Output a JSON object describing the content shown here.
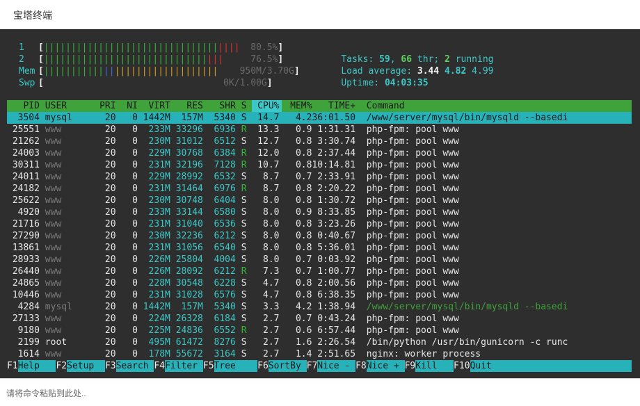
{
  "window": {
    "title": "宝塔终端"
  },
  "meters": [
    {
      "label": "1",
      "bars_green": "||||||||||||||||||||||||||||||||",
      "bars_blue": "",
      "bars_orange": "",
      "bars_red": "||||",
      "pad": "  ",
      "value": "80.5%"
    },
    {
      "label": "2",
      "bars_green": "||||||||||||||||||||||||||||||",
      "bars_blue": "",
      "bars_orange": "",
      "bars_red": "|||",
      "pad": "     ",
      "value": "76.5%"
    },
    {
      "label": "Mem",
      "bars_green": "|||||||||||",
      "bars_blue": "||",
      "bars_orange": "|||||||||||||||||||",
      "bars_red": "",
      "pad": "    ",
      "value": "950M/3.70G"
    },
    {
      "label": "Swp",
      "bars_green": "",
      "bars_blue": "",
      "bars_orange": "",
      "bars_red": "",
      "pad": "                                 ",
      "value": "0K/1.00G"
    }
  ],
  "stats": {
    "tasks_label": "Tasks: ",
    "tasks": "59",
    "thr": "66",
    "thr_label": " thr; ",
    "running": "2",
    "running_label": " running",
    "load_label": "Load average: ",
    "load1": "3.44",
    "load5": "4.82",
    "load15": "4.99",
    "uptime_label": "Uptime: ",
    "uptime": "04:03:35"
  },
  "columns": {
    "pid": "PID",
    "user": "USER",
    "pri": "PRI",
    "ni": "NI",
    "virt": "VIRT",
    "res": "RES",
    "shr": "SHR",
    "s": "S",
    "cpu": "CPU%",
    "mem": "MEM%",
    "time": "TIME+",
    "command": "Command"
  },
  "processes": [
    {
      "pid": "3504",
      "user": "mysql",
      "pri": "20",
      "ni": "0",
      "virt": "1442M",
      "res": "157M",
      "shr": "5340",
      "s": "S",
      "cpu": "14.7",
      "mem": "4.2",
      "time": "36:01.50",
      "command": "/www/server/mysql/bin/mysqld --basedi"
    },
    {
      "pid": "25551",
      "user": "www",
      "pri": "20",
      "ni": "0",
      "virt": "233M",
      "res": "33296",
      "shr": "6936",
      "s": "R",
      "cpu": "13.3",
      "mem": "0.9",
      "time": "1:31.31",
      "command": "php-fpm: pool www"
    },
    {
      "pid": "21262",
      "user": "www",
      "pri": "20",
      "ni": "0",
      "virt": "230M",
      "res": "31012",
      "shr": "6512",
      "s": "S",
      "cpu": "12.7",
      "mem": "0.8",
      "time": "3:30.74",
      "command": "php-fpm: pool www"
    },
    {
      "pid": "24003",
      "user": "www",
      "pri": "20",
      "ni": "0",
      "virt": "229M",
      "res": "30768",
      "shr": "6384",
      "s": "R",
      "cpu": "12.0",
      "mem": "0.8",
      "time": "2:37.44",
      "command": "php-fpm: pool www"
    },
    {
      "pid": "30311",
      "user": "www",
      "pri": "20",
      "ni": "0",
      "virt": "231M",
      "res": "32196",
      "shr": "7128",
      "s": "R",
      "cpu": "10.7",
      "mem": "0.8",
      "time": "10:14.81",
      "command": "php-fpm: pool www"
    },
    {
      "pid": "24011",
      "user": "www",
      "pri": "20",
      "ni": "0",
      "virt": "229M",
      "res": "28992",
      "shr": "6532",
      "s": "S",
      "cpu": "8.7",
      "mem": "0.7",
      "time": "2:33.91",
      "command": "php-fpm: pool www"
    },
    {
      "pid": "24182",
      "user": "www",
      "pri": "20",
      "ni": "0",
      "virt": "231M",
      "res": "31464",
      "shr": "6976",
      "s": "R",
      "cpu": "8.7",
      "mem": "0.8",
      "time": "2:20.22",
      "command": "php-fpm: pool www"
    },
    {
      "pid": "25622",
      "user": "www",
      "pri": "20",
      "ni": "0",
      "virt": "230M",
      "res": "30748",
      "shr": "6404",
      "s": "S",
      "cpu": "8.0",
      "mem": "0.8",
      "time": "1:30.72",
      "command": "php-fpm: pool www"
    },
    {
      "pid": "4920",
      "user": "www",
      "pri": "20",
      "ni": "0",
      "virt": "233M",
      "res": "33144",
      "shr": "6580",
      "s": "S",
      "cpu": "8.0",
      "mem": "0.9",
      "time": "8:33.85",
      "command": "php-fpm: pool www"
    },
    {
      "pid": "21716",
      "user": "www",
      "pri": "20",
      "ni": "0",
      "virt": "231M",
      "res": "31040",
      "shr": "6536",
      "s": "S",
      "cpu": "8.0",
      "mem": "0.8",
      "time": "3:23.26",
      "command": "php-fpm: pool www"
    },
    {
      "pid": "27290",
      "user": "www",
      "pri": "20",
      "ni": "0",
      "virt": "230M",
      "res": "32236",
      "shr": "6212",
      "s": "S",
      "cpu": "8.0",
      "mem": "0.8",
      "time": "0:40.67",
      "command": "php-fpm: pool www"
    },
    {
      "pid": "13861",
      "user": "www",
      "pri": "20",
      "ni": "0",
      "virt": "231M",
      "res": "31056",
      "shr": "6540",
      "s": "S",
      "cpu": "8.0",
      "mem": "0.8",
      "time": "5:36.01",
      "command": "php-fpm: pool www"
    },
    {
      "pid": "28933",
      "user": "www",
      "pri": "20",
      "ni": "0",
      "virt": "226M",
      "res": "25804",
      "shr": "4004",
      "s": "S",
      "cpu": "8.0",
      "mem": "0.7",
      "time": "0:03.92",
      "command": "php-fpm: pool www"
    },
    {
      "pid": "26440",
      "user": "www",
      "pri": "20",
      "ni": "0",
      "virt": "226M",
      "res": "28092",
      "shr": "6212",
      "s": "R",
      "cpu": "7.3",
      "mem": "0.7",
      "time": "1:00.77",
      "command": "php-fpm: pool www"
    },
    {
      "pid": "24865",
      "user": "www",
      "pri": "20",
      "ni": "0",
      "virt": "228M",
      "res": "30548",
      "shr": "6228",
      "s": "S",
      "cpu": "4.7",
      "mem": "0.8",
      "time": "2:00.56",
      "command": "php-fpm: pool www"
    },
    {
      "pid": "10446",
      "user": "www",
      "pri": "20",
      "ni": "0",
      "virt": "231M",
      "res": "31028",
      "shr": "6576",
      "s": "S",
      "cpu": "4.7",
      "mem": "0.8",
      "time": "6:38.35",
      "command": "php-fpm: pool www"
    },
    {
      "pid": "4284",
      "user": "mysql",
      "pri": "20",
      "ni": "0",
      "virt": "1442M",
      "res": "157M",
      "shr": "5340",
      "s": "S",
      "cpu": "3.3",
      "mem": "4.2",
      "time": "1:38.94",
      "command": "/www/server/mysql/bin/mysqld --basedi"
    },
    {
      "pid": "27133",
      "user": "www",
      "pri": "20",
      "ni": "0",
      "virt": "224M",
      "res": "26328",
      "shr": "6184",
      "s": "S",
      "cpu": "2.7",
      "mem": "0.7",
      "time": "0:43.24",
      "command": "php-fpm: pool www"
    },
    {
      "pid": "9180",
      "user": "www",
      "pri": "20",
      "ni": "0",
      "virt": "225M",
      "res": "24836",
      "shr": "6552",
      "s": "R",
      "cpu": "2.7",
      "mem": "0.6",
      "time": "6:57.44",
      "command": "php-fpm: pool www"
    },
    {
      "pid": "2199",
      "user": "root",
      "pri": "20",
      "ni": "0",
      "virt": "495M",
      "res": "61472",
      "shr": "8276",
      "s": "S",
      "cpu": "2.7",
      "mem": "1.6",
      "time": "2:26.54",
      "command": "/bin/python /usr/bin/gunicorn -c runc"
    },
    {
      "pid": "1614",
      "user": "www",
      "pri": "20",
      "ni": "0",
      "virt": "178M",
      "res": "55672",
      "shr": "3164",
      "s": "S",
      "cpu": "2.7",
      "mem": "1.4",
      "time": "2:51.65",
      "command": "nginx: worker process"
    }
  ],
  "function_keys": [
    {
      "key": "F1",
      "label": "Help  "
    },
    {
      "key": "F2",
      "label": "Setup "
    },
    {
      "key": "F3",
      "label": "Search"
    },
    {
      "key": "F4",
      "label": "Filter"
    },
    {
      "key": "F5",
      "label": "Tree  "
    },
    {
      "key": "F6",
      "label": "SortBy"
    },
    {
      "key": "F7",
      "label": "Nice -"
    },
    {
      "key": "F8",
      "label": "Nice +"
    },
    {
      "key": "F9",
      "label": "Kill  "
    },
    {
      "key": "F10",
      "label": "Quit"
    }
  ],
  "input": {
    "placeholder": "请将命令粘贴到此处.."
  },
  "colors": {
    "terminal_bg": "#2e2e2e",
    "header_bg": "#3fa23a",
    "selection_bg": "#27b1b9",
    "cyan": "#3cc8c8"
  }
}
